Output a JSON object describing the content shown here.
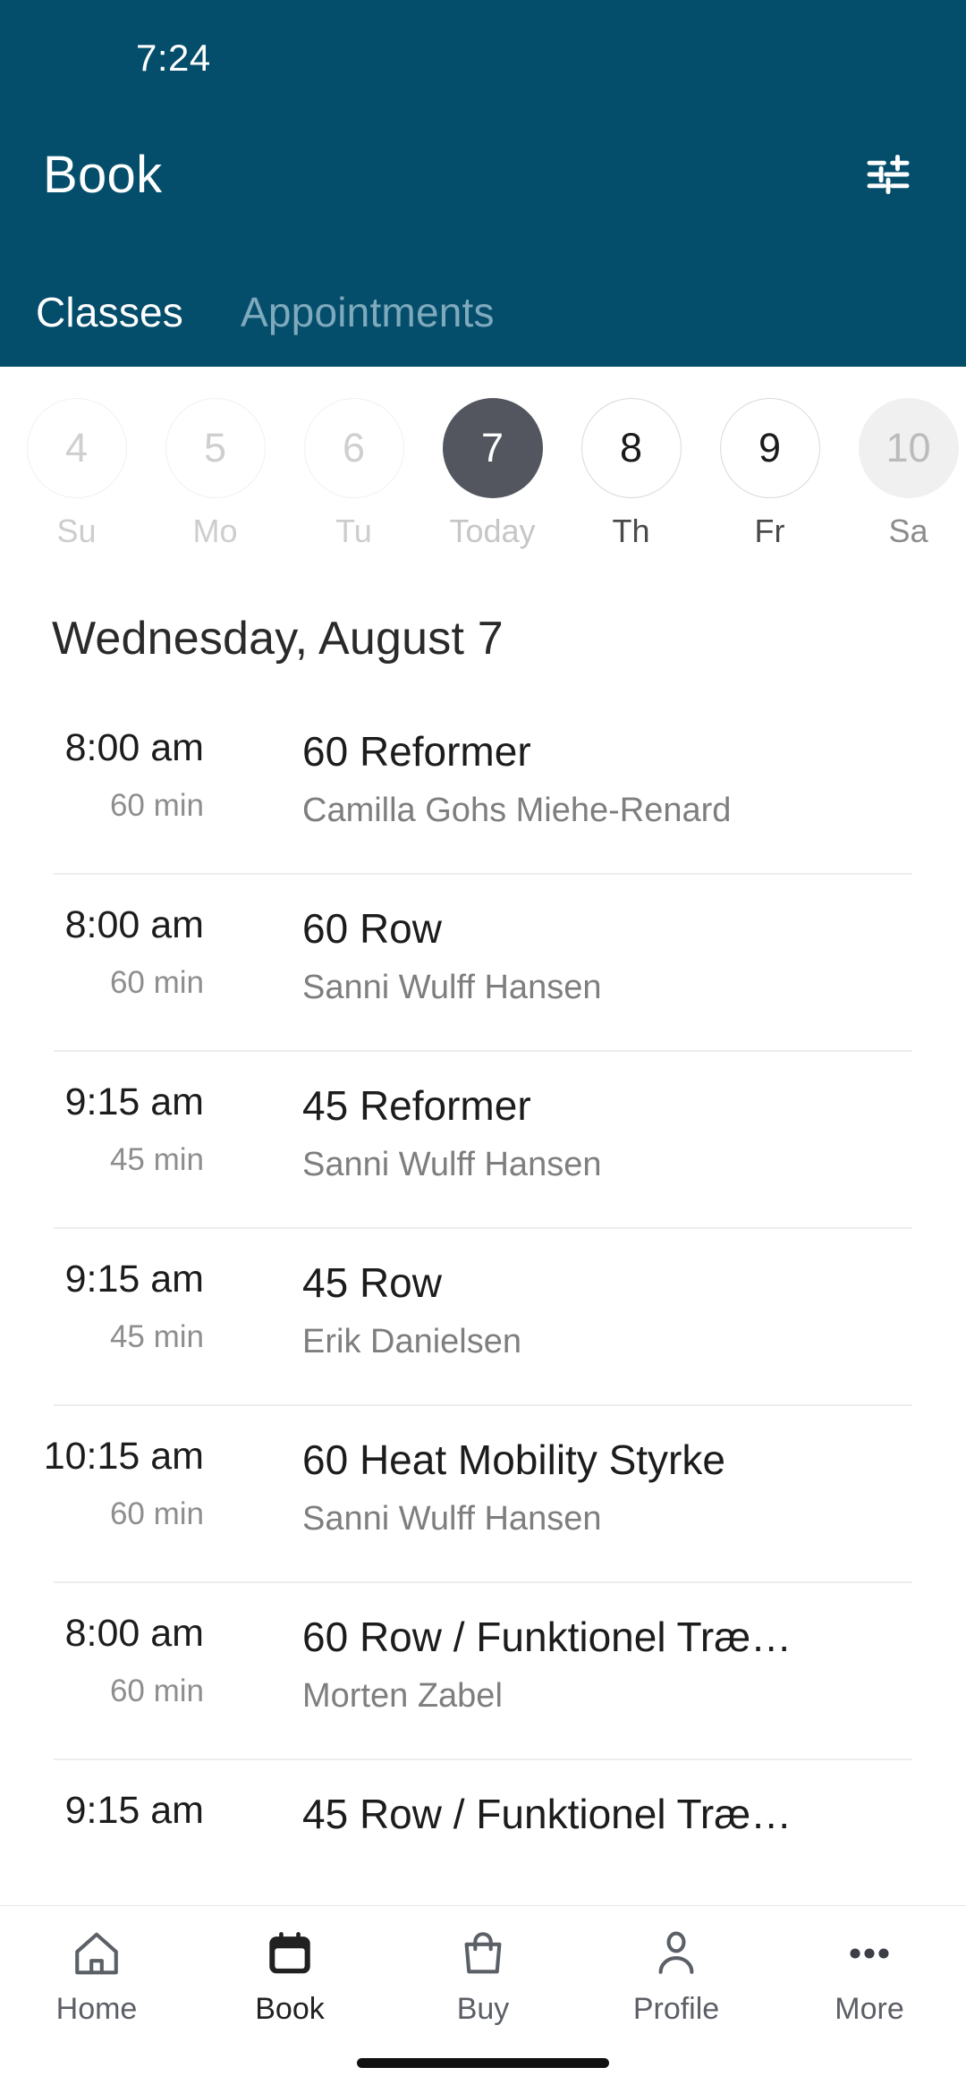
{
  "status_bar": {
    "time": "7:24"
  },
  "header": {
    "title": "Book",
    "filter_icon": "tune-sliders-icon",
    "background_color": "#044E6B",
    "tabs": [
      {
        "label": "Classes",
        "active": true
      },
      {
        "label": "Appointments",
        "active": false
      }
    ]
  },
  "date_strip": {
    "days": [
      {
        "date": "4",
        "weekday": "Su",
        "state": "disabled"
      },
      {
        "date": "5",
        "weekday": "Mo",
        "state": "disabled"
      },
      {
        "date": "6",
        "weekday": "Tu",
        "state": "disabled"
      },
      {
        "date": "7",
        "weekday": "Today",
        "state": "selected"
      },
      {
        "date": "8",
        "weekday": "Th",
        "state": "enabled"
      },
      {
        "date": "9",
        "weekday": "Fr",
        "state": "enabled"
      },
      {
        "date": "10",
        "weekday": "Sa",
        "state": "muted"
      }
    ],
    "selected_color": "#53565E"
  },
  "content": {
    "date_heading": "Wednesday, August 7",
    "classes": [
      {
        "time": "8:00 am",
        "duration": "60 min",
        "name": "60 Reformer",
        "coach": "Camilla Gohs Miehe-Renard"
      },
      {
        "time": "8:00 am",
        "duration": "60 min",
        "name": "60 Row",
        "coach": "Sanni Wulff Hansen"
      },
      {
        "time": "9:15 am",
        "duration": "45 min",
        "name": "45 Reformer",
        "coach": "Sanni Wulff Hansen"
      },
      {
        "time": "9:15 am",
        "duration": "45 min",
        "name": "45 Row",
        "coach": "Erik Danielsen"
      },
      {
        "time": "10:15 am",
        "duration": "60 min",
        "name": "60 Heat Mobility Styrke",
        "coach": "Sanni Wulff Hansen"
      },
      {
        "time": "8:00 am",
        "duration": "60 min",
        "name": "60 Row / Funktionel Træ…",
        "coach": "Morten Zabel"
      },
      {
        "time": "9:15 am",
        "duration": "",
        "name": "45 Row / Funktionel Træ…",
        "coach": ""
      }
    ]
  },
  "bottom_nav": {
    "items": [
      {
        "label": "Home",
        "icon": "home-icon",
        "active": false
      },
      {
        "label": "Book",
        "icon": "calendar-icon",
        "active": true
      },
      {
        "label": "Buy",
        "icon": "shopping-bag-icon",
        "active": false
      },
      {
        "label": "Profile",
        "icon": "person-icon",
        "active": false
      },
      {
        "label": "More",
        "icon": "ellipsis-icon",
        "active": false
      }
    ]
  }
}
